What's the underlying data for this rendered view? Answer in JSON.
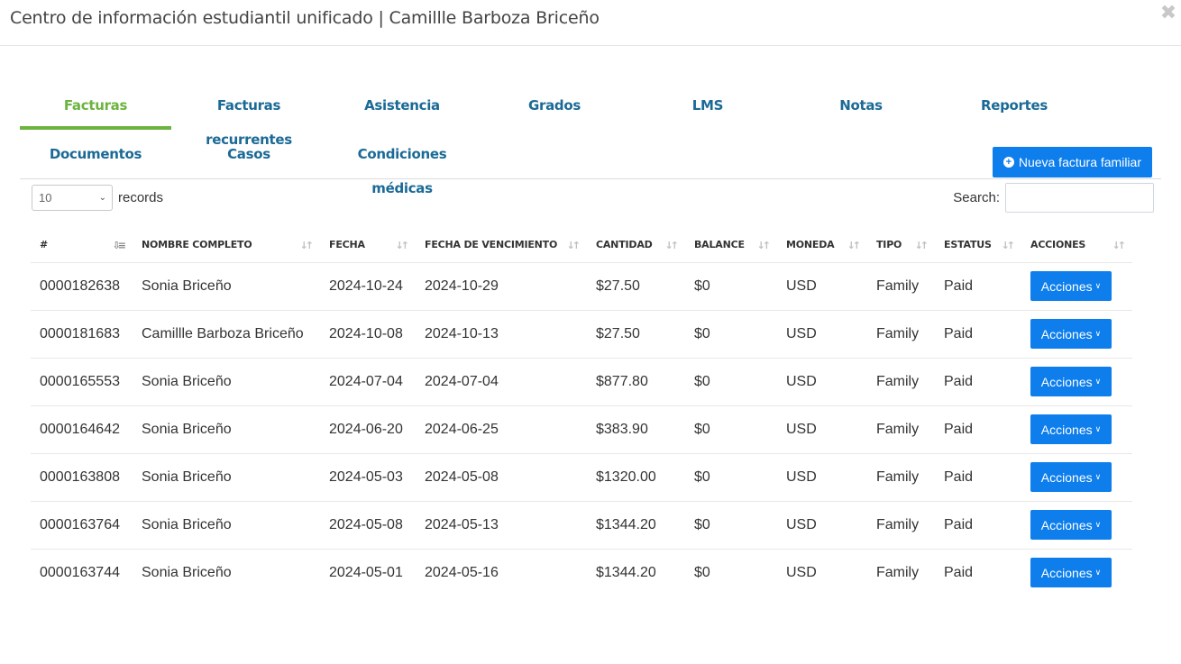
{
  "modal": {
    "title": "Centro de información estudiantil unificado | Camillle Barboza Briceño",
    "close_glyph": "✖"
  },
  "tabs": [
    {
      "label": "Facturas",
      "active": true
    },
    {
      "label": "Facturas recurrentes"
    },
    {
      "label": "Asistencia"
    },
    {
      "label": "Grados"
    },
    {
      "label": "LMS"
    },
    {
      "label": "Notas"
    },
    {
      "label": "Reportes"
    },
    {
      "label": "Documentos"
    },
    {
      "label": "Casos"
    },
    {
      "label": "Condiciones médicas"
    }
  ],
  "toolbar": {
    "new_invoice_label": "Nueva factura familiar"
  },
  "length": {
    "value": "10",
    "suffix": "records"
  },
  "search": {
    "label": "Search:",
    "value": ""
  },
  "table": {
    "columns": [
      "#",
      "Nombre completo",
      "Fecha",
      "Fecha de vencimiento",
      "Cantidad",
      "Balance",
      "Moneda",
      "Tipo",
      "Estatus",
      "Acciones"
    ],
    "action_label": "Acciones",
    "rows": [
      [
        "0000182638",
        "Sonia Briceño",
        "2024-10-24",
        "2024-10-29",
        "$27.50",
        "$0",
        "USD",
        "Family",
        "Paid"
      ],
      [
        "0000181683",
        "Camillle Barboza Briceño",
        "2024-10-08",
        "2024-10-13",
        "$27.50",
        "$0",
        "USD",
        "Family",
        "Paid"
      ],
      [
        "0000165553",
        "Sonia Briceño",
        "2024-07-04",
        "2024-07-04",
        "$877.80",
        "$0",
        "USD",
        "Family",
        "Paid"
      ],
      [
        "0000164642",
        "Sonia Briceño",
        "2024-06-20",
        "2024-06-25",
        "$383.90",
        "$0",
        "USD",
        "Family",
        "Paid"
      ],
      [
        "0000163808",
        "Sonia Briceño",
        "2024-05-03",
        "2024-05-08",
        "$1320.00",
        "$0",
        "USD",
        "Family",
        "Paid"
      ],
      [
        "0000163764",
        "Sonia Briceño",
        "2024-05-08",
        "2024-05-13",
        "$1344.20",
        "$0",
        "USD",
        "Family",
        "Paid"
      ],
      [
        "0000163744",
        "Sonia Briceño",
        "2024-05-01",
        "2024-05-16",
        "$1344.20",
        "$0",
        "USD",
        "Family",
        "Paid"
      ]
    ]
  },
  "colors": {
    "accent_green": "#6cb33f",
    "tab_blue": "#1b6a96",
    "button_blue": "#0d7eec"
  }
}
